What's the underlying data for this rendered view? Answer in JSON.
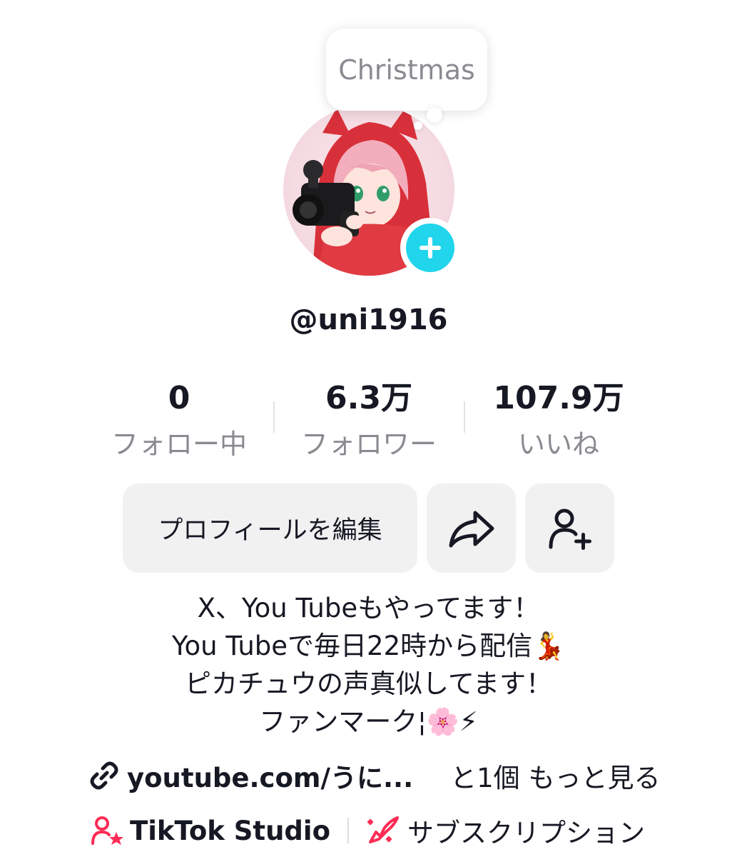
{
  "profile": {
    "status_bubble": "Christmas",
    "username": "@uni1916"
  },
  "stats": [
    {
      "value": "0",
      "label": "フォロー中"
    },
    {
      "value": "6.3万",
      "label": "フォロワー"
    },
    {
      "value": "107.9万",
      "label": "いいね"
    }
  ],
  "actions": {
    "edit_profile": "プロフィールを編集",
    "share_icon": "share-arrow-icon",
    "add_friend_icon": "add-user-icon"
  },
  "bio": [
    "X、You Tubeもやってます！",
    "You Tubeで毎日22時から配信💃",
    "ピカチュウの声真似してます！",
    "ファンマーク¦🌸⚡"
  ],
  "link": {
    "icon": "link-icon",
    "text": "youtube.com/うに...",
    "more": "と1個 もっと見る"
  },
  "tools": {
    "studio_label": "TikTok Studio",
    "subscription_label": "サブスクリプション"
  },
  "colors": {
    "accent_cyan": "#20d5ec",
    "accent_pink": "#fe2c55",
    "button_bg": "#f1f1f2",
    "secondary_text": "#8a8b91"
  }
}
